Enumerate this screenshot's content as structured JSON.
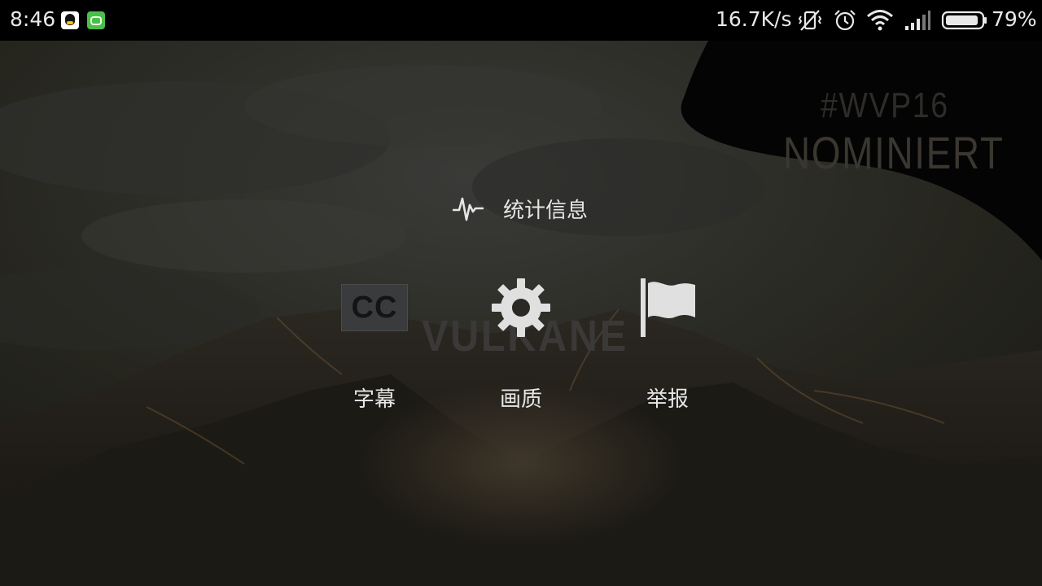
{
  "status_bar": {
    "time": "8:46",
    "notification_icons": [
      "qq-icon",
      "game-app-icon"
    ],
    "network_speed": "16.7K/s",
    "system_icons": [
      "vibrate-off-icon",
      "alarm-icon",
      "wifi-icon",
      "signal-icon",
      "battery-icon"
    ],
    "battery_percent": "79%",
    "battery_level": 0.79
  },
  "video": {
    "corner_tag": {
      "line1": "#WVP16",
      "line2": "NOMINIERT"
    },
    "title_watermark": "VULKANE"
  },
  "overlay_menu": {
    "stats": {
      "label": "统计信息",
      "icon": "pulse-icon"
    },
    "options": [
      {
        "label": "字幕",
        "icon": "closed-captions-icon",
        "icon_text": "CC"
      },
      {
        "label": "画质",
        "icon": "gear-icon"
      },
      {
        "label": "举报",
        "icon": "flag-icon"
      }
    ]
  },
  "colors": {
    "status_bar_bg": "#000000",
    "overlay_text": "#e6e6e6",
    "icon_color": "#e0e0e0",
    "cc_box_bg": "#3a3b3c"
  }
}
